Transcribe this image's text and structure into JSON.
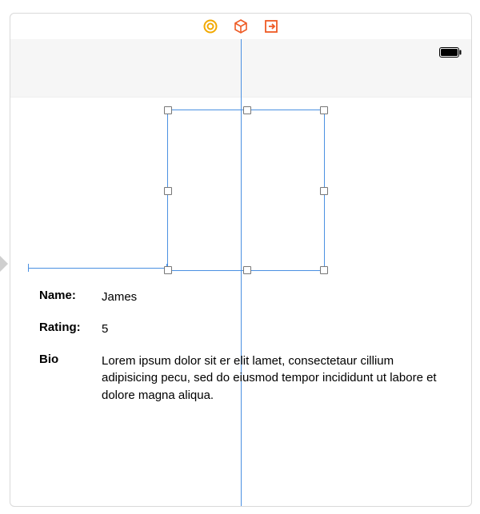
{
  "toolbar": {
    "icons": {
      "intrinsic": "intrinsic-size-icon",
      "object": "3d-object-icon",
      "embed": "embed-in-icon"
    }
  },
  "fields": {
    "name": {
      "label": "Name:",
      "value": "James"
    },
    "rating": {
      "label": "Rating:",
      "value": "5"
    },
    "bio": {
      "label": "Bio",
      "value": "Lorem ipsum dolor sit er elit lamet, consectetaur cillium adipisicing pecu, sed do eiusmod tempor incididunt ut labore et dolore magna aliqua."
    }
  }
}
